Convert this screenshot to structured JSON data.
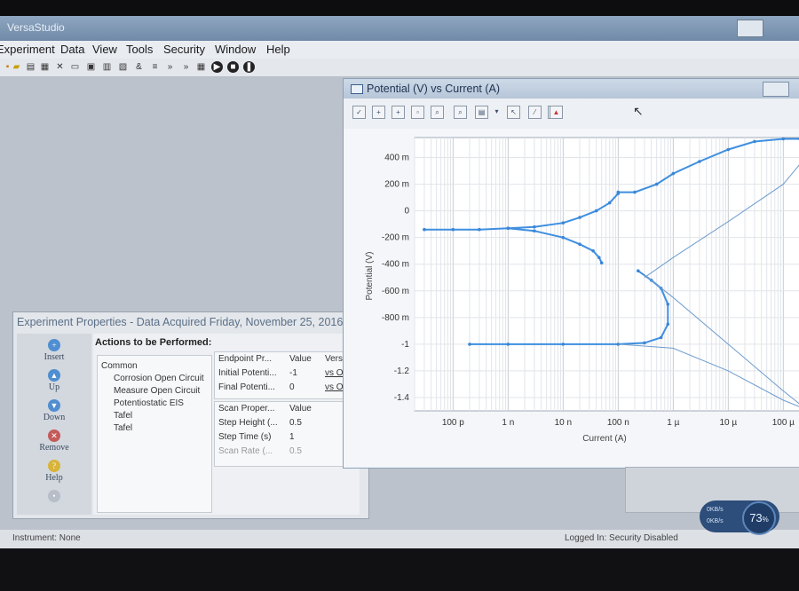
{
  "app": {
    "title": "VersaStudio"
  },
  "menu": [
    "Experiment",
    "Data",
    "View",
    "Tools",
    "Security",
    "Window",
    "Help"
  ],
  "experiment_window": {
    "title": "Experiment Properties - Data Acquired Friday, November 25, 2016",
    "side_buttons": [
      "Insert",
      "Up",
      "Down",
      "Remove",
      "Help"
    ],
    "actions_header": "Actions to be Performed:",
    "tree": {
      "group": "Common",
      "items": [
        "Corrosion Open Circuit",
        "Measure Open Circuit",
        "Potentiostatic EIS",
        "Tafel",
        "Tafel"
      ]
    },
    "endpoint_table": {
      "headers": [
        "Endpoint Pr...",
        "Value",
        "Vers"
      ],
      "rows": [
        [
          "Initial Potenti...",
          "-1",
          "vs O"
        ],
        [
          "Final Potenti...",
          "0",
          "vs O"
        ]
      ]
    },
    "scan_table": {
      "headers": [
        "Scan Proper...",
        "Value"
      ],
      "rows": [
        [
          "Step Height (...",
          "0.5"
        ],
        [
          "Step Time (s)",
          "1"
        ],
        [
          "Scan Rate (...",
          "0.5"
        ]
      ]
    }
  },
  "plot_window": {
    "title": "Potential (V) vs Current (A)"
  },
  "status": {
    "instrument": "Instrument: None",
    "login": "Logged In: Security Disabled"
  },
  "gadget": {
    "percent": "73",
    "unit": "%",
    "line1": "0KB/s",
    "line2": "0KB/s"
  },
  "chart_data": {
    "type": "scatter",
    "xlabel": "Current (A)",
    "ylabel": "Potential (V)",
    "x_scale": "log",
    "x_ticks": [
      "100 p",
      "1 n",
      "10 n",
      "100 n",
      "1 µ",
      "10 µ",
      "100 µ"
    ],
    "x_tick_values": [
      1e-10,
      1e-09,
      1e-08,
      1e-07,
      1e-06,
      1e-05,
      0.0001
    ],
    "y_ticks": [
      "400 m",
      "200 m",
      "0",
      "-200 m",
      "-400 m",
      "-600 m",
      "-800 m",
      "-1",
      "-1.2",
      "-1.4"
    ],
    "y_tick_values": [
      0.4,
      0.2,
      0,
      -0.2,
      -0.4,
      -0.6,
      -0.8,
      -1.0,
      -1.2,
      -1.4
    ],
    "xlim": [
      2e-11,
      0.0002
    ],
    "ylim": [
      -1.5,
      0.55
    ],
    "grid": true,
    "series": [
      {
        "x": [
          3e-11,
          1e-10,
          3e-10,
          1e-09,
          3e-09,
          1e-08,
          2e-08,
          4e-08,
          7e-08,
          1e-07
        ],
        "y": [
          -0.14,
          -0.14,
          -0.14,
          -0.13,
          -0.12,
          -0.09,
          -0.05,
          0.0,
          0.06,
          0.13
        ]
      },
      {
        "x": [
          1e-09,
          3e-09,
          1e-08,
          2e-08,
          3.5e-08,
          4.5e-08,
          5e-08
        ],
        "y": [
          -0.13,
          -0.15,
          -0.2,
          -0.25,
          -0.3,
          -0.35,
          -0.39
        ]
      },
      {
        "x": [
          1e-07,
          2e-07,
          5e-07,
          1e-06,
          3e-06,
          1e-05,
          3e-05,
          0.0001,
          0.0002
        ],
        "y": [
          0.14,
          0.14,
          0.2,
          0.28,
          0.37,
          0.46,
          0.52,
          0.54,
          0.54
        ]
      },
      {
        "x": [
          2e-10,
          1e-09,
          1e-08,
          1e-07,
          3e-07,
          6e-07,
          8e-07,
          8e-07,
          6e-07,
          4e-07,
          2.3e-07
        ],
        "y": [
          -1.0,
          -1.0,
          -1.0,
          -1.0,
          -0.99,
          -0.95,
          -0.85,
          -0.7,
          -0.58,
          -0.52,
          -0.45
        ]
      },
      {
        "x": [
          3e-07,
          1e-06,
          1e-05,
          0.0001,
          0.0002
        ],
        "y": [
          -0.5,
          -0.35,
          -0.08,
          0.2,
          0.35
        ]
      },
      {
        "x": [
          3e-07,
          1e-06,
          1e-05,
          0.0001,
          0.0002
        ],
        "y": [
          -0.48,
          -0.65,
          -1.0,
          -1.35,
          -1.45
        ]
      },
      {
        "x": [
          1e-07,
          1e-06,
          1e-05,
          0.0001,
          0.0002
        ],
        "y": [
          -1.0,
          -1.03,
          -1.2,
          -1.42,
          -1.47
        ]
      }
    ]
  }
}
